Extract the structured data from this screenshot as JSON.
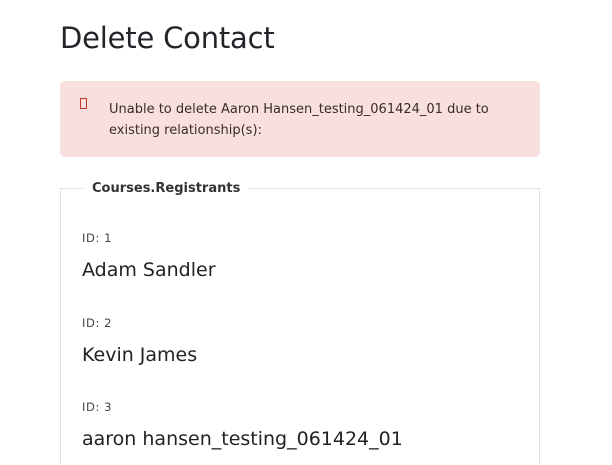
{
  "page": {
    "title": "Delete Contact"
  },
  "alert": {
    "icon": "warning-icon",
    "message": "Unable to delete Aaron Hansen_testing_061424_01 due to existing relationship(s):",
    "color": "#f8e0df"
  },
  "relationship_group": {
    "legend": "Courses.Registrants",
    "records": [
      {
        "id_label": "ID: 1",
        "name": "Adam Sandler"
      },
      {
        "id_label": "ID: 2",
        "name": "Kevin James"
      },
      {
        "id_label": "ID: 3",
        "name": "aaron hansen_testing_061424_01"
      }
    ]
  }
}
